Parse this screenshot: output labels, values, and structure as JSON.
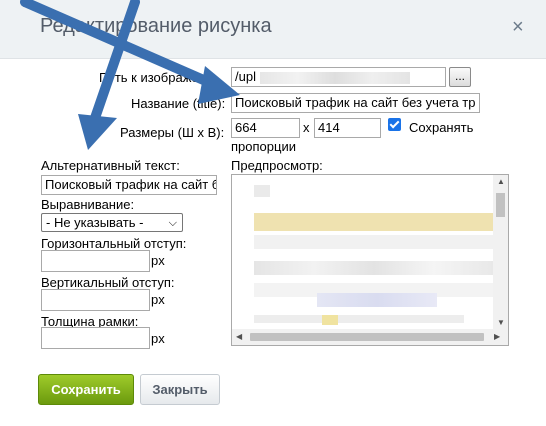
{
  "dialog": {
    "title": "Редактирование рисунка",
    "close_glyph": "×"
  },
  "form": {
    "path_label": "Путь к изображен",
    "path_value": "/upl",
    "browse_label": "...",
    "name_label": "Название (title):",
    "name_value": "Поисковый трафик на сайт без учета тр",
    "size_label": "Размеры (Ш х В):",
    "width_value": "664",
    "size_separator": "x",
    "height_value": "414",
    "keep_proportions_label_1": "Сохранять",
    "keep_proportions_label_2": "пропорции",
    "keep_proportions_checked": true,
    "alt_label": "Альтернативный текст:",
    "alt_value": "Поисковый трафик на сайт б",
    "align_label": "Выравнивание:",
    "align_value": "- Не указывать -",
    "hspace_label": "Горизонтальный отступ:",
    "vspace_label": "Вертикальный отступ:",
    "border_label": "Толщина рамки:",
    "unit_px": "px",
    "preview_label": "Предпросмотр:"
  },
  "buttons": {
    "save": "Сохранить",
    "close": "Закрыть"
  },
  "colors": {
    "arrow": "#3a6fb0",
    "save_green": "#7aab14",
    "checkbox": "#1a73e8"
  }
}
